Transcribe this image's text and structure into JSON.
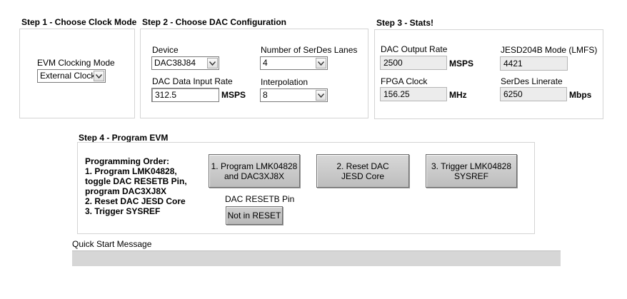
{
  "step1": {
    "title": "Step 1 - Choose Clock Mode",
    "clock_mode_label": "EVM Clocking Mode",
    "clock_mode_value": "External Clock"
  },
  "step2": {
    "title": "Step 2 - Choose DAC Configuration",
    "device_label": "Device",
    "device_value": "DAC38J84",
    "lanes_label": "Number of SerDes Lanes",
    "lanes_value": "4",
    "rate_label": "DAC Data Input Rate",
    "rate_value": "312.5",
    "rate_unit": "MSPS",
    "interp_label": "Interpolation",
    "interp_value": "8"
  },
  "step3": {
    "title": "Step 3 - Stats!",
    "dac_output_label": "DAC Output Rate",
    "dac_output_value": "2500",
    "dac_output_unit": "MSPS",
    "jesd_mode_label": "JESD204B Mode (LMFS)",
    "jesd_mode_value": "4421",
    "fpga_clock_label": "FPGA Clock",
    "fpga_clock_value": "156.25",
    "fpga_clock_unit": "MHz",
    "serdes_label": "SerDes Linerate",
    "serdes_value": "6250",
    "serdes_unit": "Mbps"
  },
  "step4": {
    "title": "Step 4 - Program EVM",
    "order_text": "Programming Order:\n1. Program LMK04828,\n    toggle DAC RESETB Pin,\n    program DAC3XJ8X\n2. Reset DAC JESD Core\n3. Trigger SYSREF",
    "btn_program": "1. Program LMK04828\nand DAC3XJ8X",
    "btn_reset": "2. Reset DAC\nJESD Core",
    "btn_trigger": "3. Trigger LMK04828\nSYSREF",
    "resetb_label": "DAC RESETB Pin",
    "resetb_button": "Not in RESET"
  },
  "quick_start": {
    "label": "Quick Start Message",
    "message": ""
  }
}
